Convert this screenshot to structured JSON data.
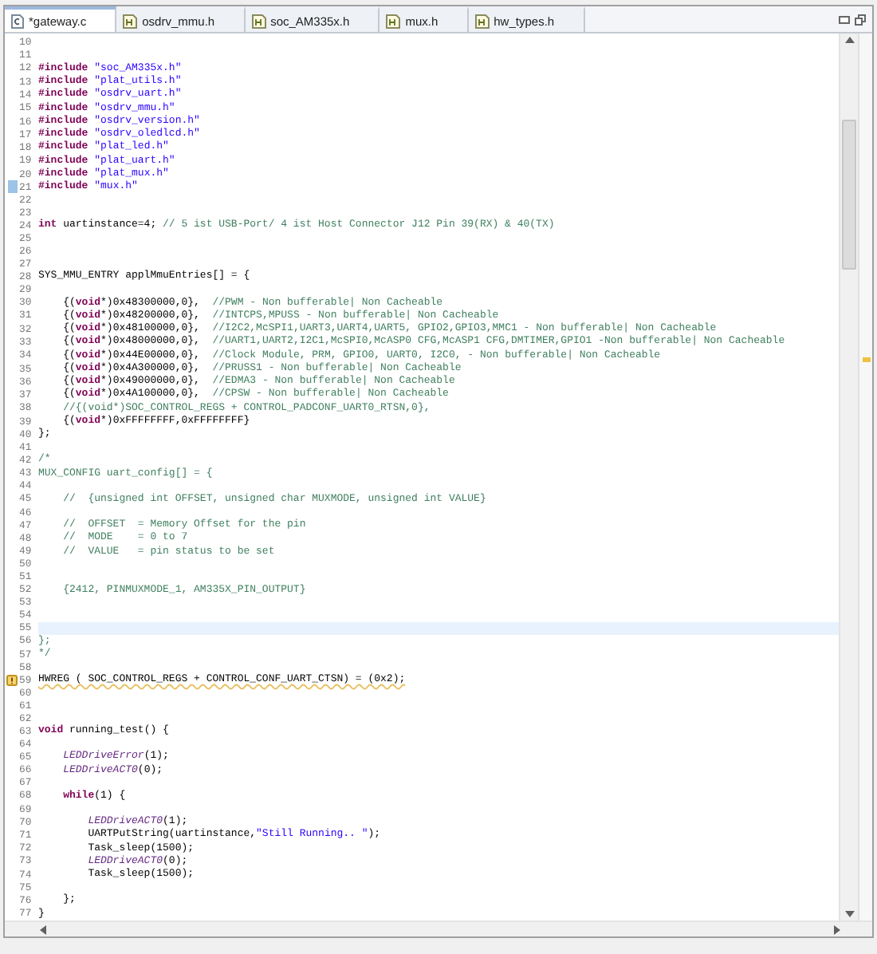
{
  "tabs": [
    {
      "label": "*gateway.c",
      "kind": "source",
      "selected": true
    },
    {
      "label": "osdrv_mmu.h",
      "kind": "header",
      "selected": false
    },
    {
      "label": "soc_AM335x.h",
      "kind": "header",
      "selected": false
    },
    {
      "label": "mux.h",
      "kind": "header",
      "selected": false
    },
    {
      "label": "hw_types.h",
      "kind": "header",
      "selected": false
    }
  ],
  "lines": [
    {
      "n": "10"
    },
    {
      "n": "11"
    },
    {
      "n": "12",
      "tokens": [
        {
          "kind": "keyword",
          "text": "#include"
        },
        {
          "kind": "string",
          "text": " \"soc_AM335x.h\""
        }
      ]
    },
    {
      "n": "13",
      "tokens": [
        {
          "kind": "keyword",
          "text": "#include"
        },
        {
          "kind": "string",
          "text": " \"plat_utils.h\""
        }
      ]
    },
    {
      "n": "14",
      "tokens": [
        {
          "kind": "keyword",
          "text": "#include"
        },
        {
          "kind": "string",
          "text": " \"osdrv_uart.h\""
        }
      ]
    },
    {
      "n": "15",
      "tokens": [
        {
          "kind": "keyword",
          "text": "#include"
        },
        {
          "kind": "string",
          "text": " \"osdrv_mmu.h\""
        }
      ]
    },
    {
      "n": "16",
      "tokens": [
        {
          "kind": "keyword",
          "text": "#include"
        },
        {
          "kind": "string",
          "text": " \"osdrv_version.h\""
        }
      ]
    },
    {
      "n": "17",
      "tokens": [
        {
          "kind": "keyword",
          "text": "#include"
        },
        {
          "kind": "string",
          "text": " \"osdrv_oledlcd.h\""
        }
      ]
    },
    {
      "n": "18",
      "tokens": [
        {
          "kind": "keyword",
          "text": "#include"
        },
        {
          "kind": "string",
          "text": " \"plat_led.h\""
        }
      ]
    },
    {
      "n": "19",
      "tokens": [
        {
          "kind": "keyword",
          "text": "#include"
        },
        {
          "kind": "string",
          "text": " \"plat_uart.h\""
        }
      ]
    },
    {
      "n": "20",
      "tokens": [
        {
          "kind": "keyword",
          "text": "#include"
        },
        {
          "kind": "string",
          "text": " \"plat_mux.h\""
        }
      ]
    },
    {
      "n": "21",
      "kind": "change",
      "tokens": [
        {
          "kind": "keyword",
          "text": "#include"
        },
        {
          "kind": "string",
          "text": " \"mux.h\""
        }
      ]
    },
    {
      "n": "22"
    },
    {
      "n": "23"
    },
    {
      "n": "24",
      "tokens": [
        {
          "kind": "keyword",
          "text": "int"
        },
        {
          "kind": "plain",
          "text": " uartinstance=4; "
        },
        {
          "kind": "comment",
          "text": "// 5 ist USB-Port/ 4 ist Host Connector J12 Pin 39(RX) & 40(TX)"
        }
      ]
    },
    {
      "n": "25"
    },
    {
      "n": "26"
    },
    {
      "n": "27"
    },
    {
      "n": "28",
      "tokens": [
        {
          "kind": "plain",
          "text": "SYS_MMU_ENTRY applMmuEntries[] = {"
        }
      ]
    },
    {
      "n": "29"
    },
    {
      "n": "30",
      "tokens": [
        {
          "kind": "plain",
          "text": "    {("
        },
        {
          "kind": "keyword",
          "text": "void"
        },
        {
          "kind": "plain",
          "text": "*)0x48300000,0},  "
        },
        {
          "kind": "comment",
          "text": "//PWM - Non bufferable| Non Cacheable"
        }
      ]
    },
    {
      "n": "31",
      "tokens": [
        {
          "kind": "plain",
          "text": "    {("
        },
        {
          "kind": "keyword",
          "text": "void"
        },
        {
          "kind": "plain",
          "text": "*)0x48200000,0},  "
        },
        {
          "kind": "comment",
          "text": "//INTCPS,MPUSS - Non bufferable| Non Cacheable"
        }
      ]
    },
    {
      "n": "32",
      "tokens": [
        {
          "kind": "plain",
          "text": "    {("
        },
        {
          "kind": "keyword",
          "text": "void"
        },
        {
          "kind": "plain",
          "text": "*)0x48100000,0},  "
        },
        {
          "kind": "comment",
          "text": "//I2C2,McSPI1,UART3,UART4,UART5, GPIO2,GPIO3,MMC1 - Non bufferable| Non Cacheable"
        }
      ]
    },
    {
      "n": "33",
      "tokens": [
        {
          "kind": "plain",
          "text": "    {("
        },
        {
          "kind": "keyword",
          "text": "void"
        },
        {
          "kind": "plain",
          "text": "*)0x48000000,0},  "
        },
        {
          "kind": "comment",
          "text": "//UART1,UART2,I2C1,McSPI0,McASP0 CFG,McASP1 CFG,DMTIMER,GPIO1 -Non bufferable| Non Cacheable"
        }
      ]
    },
    {
      "n": "34",
      "tokens": [
        {
          "kind": "plain",
          "text": "    {("
        },
        {
          "kind": "keyword",
          "text": "void"
        },
        {
          "kind": "plain",
          "text": "*)0x44E00000,0},  "
        },
        {
          "kind": "comment",
          "text": "//Clock Module, PRM, GPIO0, UART0, I2C0, - Non bufferable| Non Cacheable"
        }
      ]
    },
    {
      "n": "35",
      "tokens": [
        {
          "kind": "plain",
          "text": "    {("
        },
        {
          "kind": "keyword",
          "text": "void"
        },
        {
          "kind": "plain",
          "text": "*)0x4A300000,0},  "
        },
        {
          "kind": "comment",
          "text": "//PRUSS1 - Non bufferable| Non Cacheable"
        }
      ]
    },
    {
      "n": "36",
      "tokens": [
        {
          "kind": "plain",
          "text": "    {("
        },
        {
          "kind": "keyword",
          "text": "void"
        },
        {
          "kind": "plain",
          "text": "*)0x49000000,0},  "
        },
        {
          "kind": "comment",
          "text": "//EDMA3 - Non bufferable| Non Cacheable"
        }
      ]
    },
    {
      "n": "37",
      "tokens": [
        {
          "kind": "plain",
          "text": "    {("
        },
        {
          "kind": "keyword",
          "text": "void"
        },
        {
          "kind": "plain",
          "text": "*)0x4A100000,0},  "
        },
        {
          "kind": "comment",
          "text": "//CPSW - Non bufferable| Non Cacheable"
        }
      ]
    },
    {
      "n": "38",
      "tokens": [
        {
          "kind": "comment",
          "text": "    //{(void*)SOC_CONTROL_REGS + CONTROL_PADCONF_UART0_RTSN,0},"
        }
      ]
    },
    {
      "n": "39",
      "tokens": [
        {
          "kind": "plain",
          "text": "    {("
        },
        {
          "kind": "keyword",
          "text": "void"
        },
        {
          "kind": "plain",
          "text": "*)0xFFFFFFFF,0xFFFFFFFF}"
        }
      ]
    },
    {
      "n": "40",
      "tokens": [
        {
          "kind": "plain",
          "text": "};"
        }
      ]
    },
    {
      "n": "41"
    },
    {
      "n": "42",
      "tokens": [
        {
          "kind": "comment",
          "text": "/*"
        }
      ]
    },
    {
      "n": "43",
      "tokens": [
        {
          "kind": "comment",
          "text": "MUX_CONFIG uart_config[] = {"
        }
      ]
    },
    {
      "n": "44"
    },
    {
      "n": "45",
      "tokens": [
        {
          "kind": "comment",
          "text": "    //  {unsigned int OFFSET, unsigned char MUXMODE, unsigned int VALUE}"
        }
      ]
    },
    {
      "n": "46"
    },
    {
      "n": "47",
      "tokens": [
        {
          "kind": "comment",
          "text": "    //  OFFSET  = Memory Offset for the pin"
        }
      ]
    },
    {
      "n": "48",
      "tokens": [
        {
          "kind": "comment",
          "text": "    //  MODE    = 0 to 7"
        }
      ]
    },
    {
      "n": "49",
      "tokens": [
        {
          "kind": "comment",
          "text": "    //  VALUE   = pin status to be set"
        }
      ]
    },
    {
      "n": "50"
    },
    {
      "n": "51"
    },
    {
      "n": "52",
      "tokens": [
        {
          "kind": "comment",
          "text": "    {2412, PINMUXMODE_1, AM335X_PIN_OUTPUT}"
        }
      ]
    },
    {
      "n": "53"
    },
    {
      "n": "54"
    },
    {
      "n": "55",
      "highlighted": true
    },
    {
      "n": "56",
      "tokens": [
        {
          "kind": "comment",
          "text": "};"
        }
      ]
    },
    {
      "n": "57",
      "tokens": [
        {
          "kind": "comment",
          "text": "*/"
        }
      ]
    },
    {
      "n": "58"
    },
    {
      "n": "59",
      "kind": "warning",
      "tokens": [
        {
          "kind": "plain",
          "text": "HWREG ( SOC_CONTROL_REGS + CONTROL_CONF_UART_CTSN) = (0x2);"
        }
      ]
    },
    {
      "n": "60"
    },
    {
      "n": "61"
    },
    {
      "n": "62"
    },
    {
      "n": "63",
      "tokens": [
        {
          "kind": "keyword",
          "text": "void"
        },
        {
          "kind": "plain",
          "text": " running_test() {"
        }
      ]
    },
    {
      "n": "64"
    },
    {
      "n": "65",
      "tokens": [
        {
          "kind": "function",
          "text": "    LEDDriveError"
        },
        {
          "kind": "plain",
          "text": "(1);"
        }
      ]
    },
    {
      "n": "66",
      "tokens": [
        {
          "kind": "function",
          "text": "    LEDDriveACT0"
        },
        {
          "kind": "plain",
          "text": "(0);"
        }
      ]
    },
    {
      "n": "67"
    },
    {
      "n": "68",
      "tokens": [
        {
          "kind": "keyword",
          "text": "    while"
        },
        {
          "kind": "plain",
          "text": "(1) {"
        }
      ]
    },
    {
      "n": "69"
    },
    {
      "n": "70",
      "tokens": [
        {
          "kind": "function",
          "text": "        LEDDriveACT0"
        },
        {
          "kind": "plain",
          "text": "(1);"
        }
      ]
    },
    {
      "n": "71",
      "tokens": [
        {
          "kind": "plain",
          "text": "        UARTPutString(uartinstance,"
        },
        {
          "kind": "string",
          "text": "\"Still Running.. \""
        },
        {
          "kind": "plain",
          "text": ");"
        }
      ]
    },
    {
      "n": "72",
      "tokens": [
        {
          "kind": "plain",
          "text": "        Task_sleep(1500);"
        }
      ]
    },
    {
      "n": "73",
      "tokens": [
        {
          "kind": "function",
          "text": "        LEDDriveACT0"
        },
        {
          "kind": "plain",
          "text": "(0);"
        }
      ]
    },
    {
      "n": "74",
      "tokens": [
        {
          "kind": "plain",
          "text": "        Task_sleep(1500);"
        }
      ]
    },
    {
      "n": "75"
    },
    {
      "n": "76",
      "tokens": [
        {
          "kind": "plain",
          "text": "    };"
        }
      ]
    },
    {
      "n": "77",
      "tokens": [
        {
          "kind": "plain",
          "text": "}"
        }
      ]
    }
  ]
}
